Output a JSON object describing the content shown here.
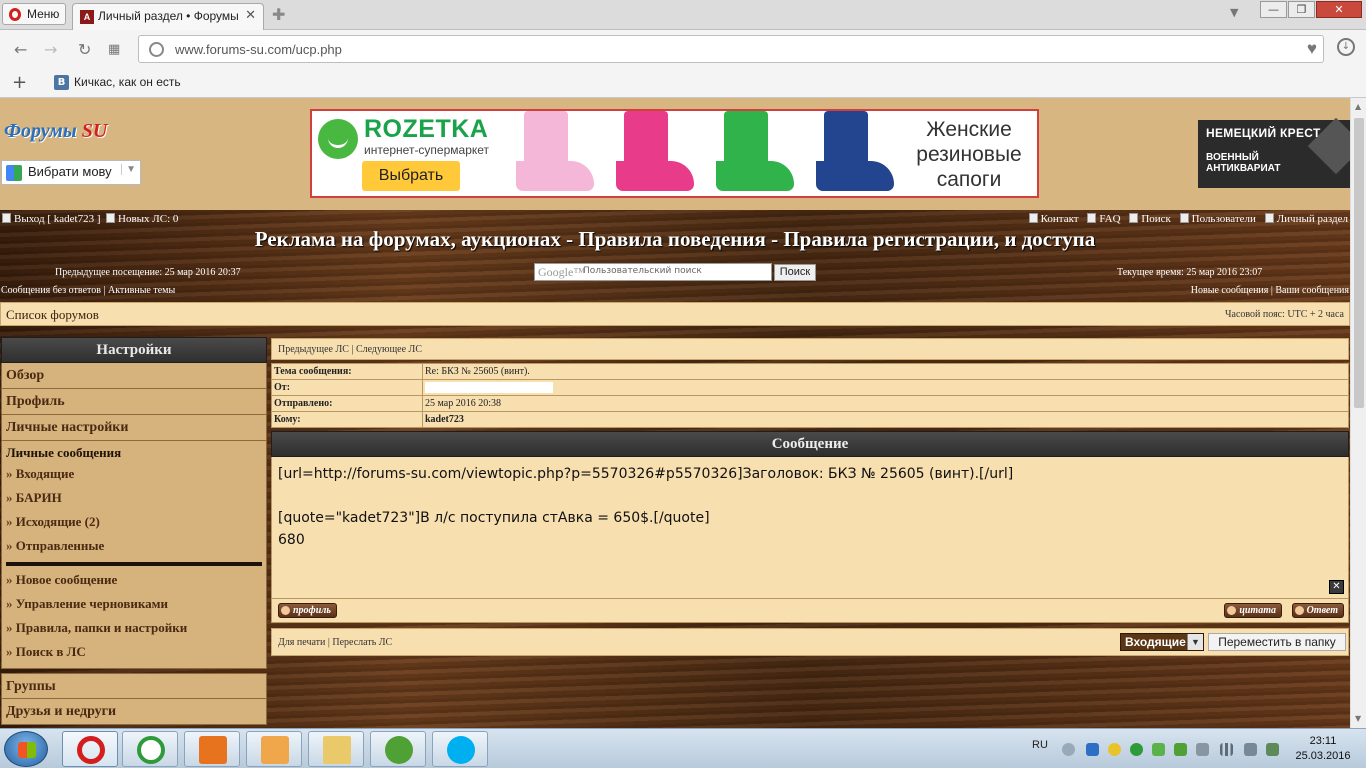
{
  "browser": {
    "menu_label": "Меню",
    "tab_title": "Личный раздел • Форумы",
    "url": "www.forums-su.com/ucp.php",
    "bookmark": "Кичкас, как он есть"
  },
  "header": {
    "logo_main": "Форумы",
    "logo_accent": "SU",
    "language_select": "Вибрати мову",
    "ad": {
      "brand": "ROZETKA",
      "tagline": "интернет-супермаркет",
      "cta": "Выбрать",
      "text_line1": "Женские",
      "text_line2": "резиновые",
      "text_line3": "сапоги",
      "colors": [
        "#f5b7d8",
        "#e83b8a",
        "#2fb34a",
        "#23458f"
      ]
    },
    "right_ad": {
      "line1": "НЕМЕЦКИЙ КРЕСТ",
      "line2": "ВОЕННЫЙ",
      "line3": "АНТИКВАРИАТ"
    }
  },
  "nav": {
    "logout": "Выход [ kadet723 ]",
    "new_pm": "Новых ЛС: 0",
    "right": [
      "Контакт",
      "FAQ",
      "Поиск",
      "Пользователи",
      "Личный раздел"
    ],
    "site_title": "Реклама на форумах, аукционах - Правила поведения - Правила регистрации, и доступа",
    "prev_visit": "Предыдущее посещение: 25 мар 2016 20:37",
    "current_time": "Текущее время: 25 мар 2016 23:07",
    "search_brand": "Google™",
    "search_placeholder": "Пользовательский поиск",
    "search_button": "Поиск",
    "links_left": "Сообщения без ответов  |  Активные темы",
    "links_right": "Новые сообщения  |  Ваши сообщения",
    "forum_list": "Список форумов",
    "timezone": "Часовой пояс: UTC + 2 часа"
  },
  "sidebar": {
    "header": "Настройки",
    "items_top": [
      "Обзор",
      "Профиль",
      "Личные настройки"
    ],
    "pm_header": "Личные сообщения",
    "pm_folders": [
      "Входящие",
      "БАРИН",
      "Исходящие (2)",
      "Отправленные"
    ],
    "pm_actions": [
      "Новое сообщение",
      "Управление черновиками",
      "Правила, папки и настройки",
      "Поиск в ЛС"
    ],
    "items_bottom": [
      "Группы",
      "Друзья и недруги"
    ]
  },
  "message": {
    "nav": "Предыдущее ЛС  |  Следующее ЛС",
    "subject_label": "Тема сообщения:",
    "subject": "Re: БКЗ № 25605 (винт).",
    "from_label": "От:",
    "sent_label": "Отправлено:",
    "sent": "25 мар 2016 20:38",
    "to_label": "Кому:",
    "to": "kadet723",
    "header": "Сообщение",
    "body_line1": "[url=http://forums-su.com/viewtopic.php?p=5570326#p5570326]Заголовок: БКЗ № 25605 (винт).[/url]",
    "body_line2": "[quote=\"kadet723\"]В л/с поступила стАвка = 650$.[/quote]",
    "body_line3": "680",
    "profile_btn": "профиль",
    "quote_btn": "цитата",
    "reply_btn": "Ответ",
    "footer_links": "Для печати  |  Переслать ЛС",
    "folder_select": "Входящие",
    "move_btn": "Переместить в папку"
  },
  "taskbar": {
    "lang": "RU",
    "time": "23:11",
    "date": "25.03.2016"
  }
}
